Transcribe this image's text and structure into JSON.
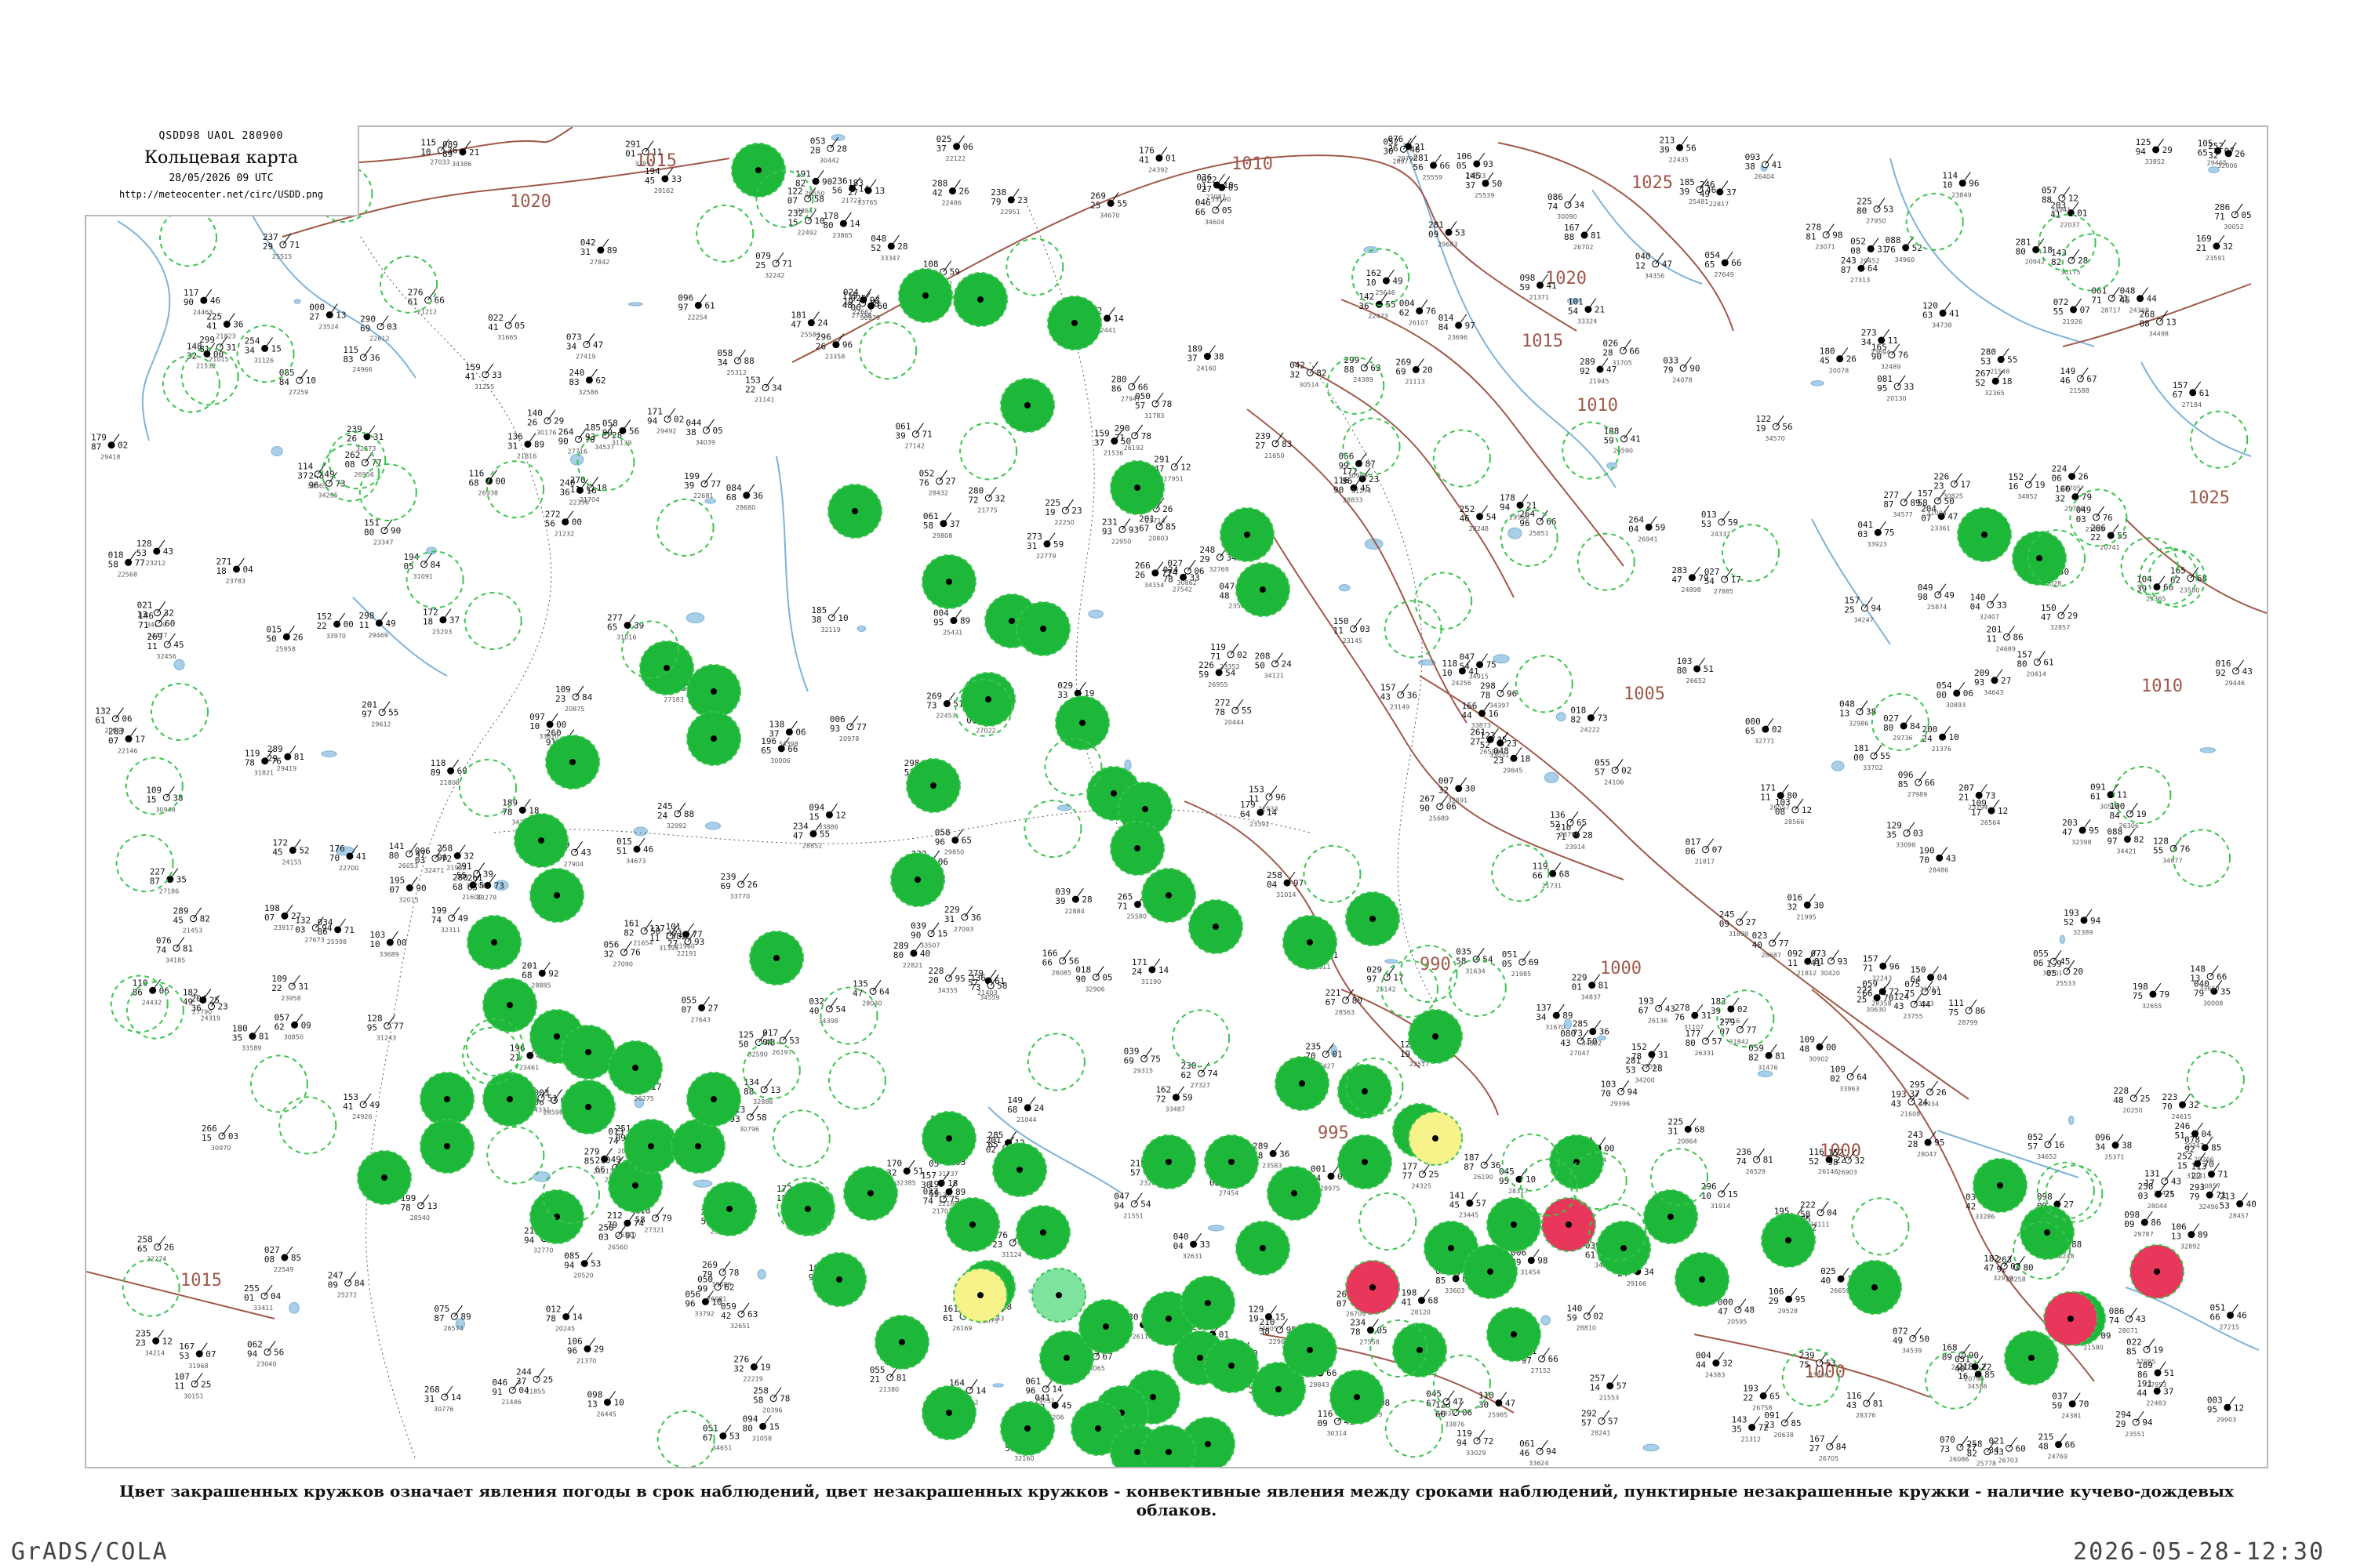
{
  "header": {
    "product_code": "QSDD98  UAOL  280900",
    "title": "Кольцевая карта",
    "date": "28/05/2026 09 UTC",
    "url": "http://meteocenter.net/circ/USDD.png"
  },
  "caption": "Цвет закрашенных кружков означает явления погоды в срок наблюдений, цвет незакрашенных кружков - конвективные явления между сроками наблюдений, пунктирные незакрашенные кружки - наличие кучево-дождевых облаков.",
  "footer": {
    "software": "GrADS/COLA",
    "timestamp": "2026-05-28-12:30"
  },
  "colors": {
    "filled_green": "#1db83a",
    "filled_red": "#e8375a",
    "filled_yellow": "#f7f28a",
    "filled_light_green": "#7fe3a0",
    "dashed_green": "#3cc34f",
    "isobar": "#a0584a",
    "water": "#7fb3d9"
  },
  "isobars": [
    {
      "label": "1015"
    },
    {
      "label": "1020"
    },
    {
      "label": "1010"
    },
    {
      "label": "1025"
    },
    {
      "label": "1005"
    },
    {
      "label": "1000"
    },
    {
      "label": "995"
    },
    {
      "label": "990"
    }
  ],
  "legend_semantics": [
    "filled circle: weather phenomenon at observation time",
    "open circle: convective phenomenon between observations",
    "dashed open circle: cumulonimbus clouds present"
  ]
}
